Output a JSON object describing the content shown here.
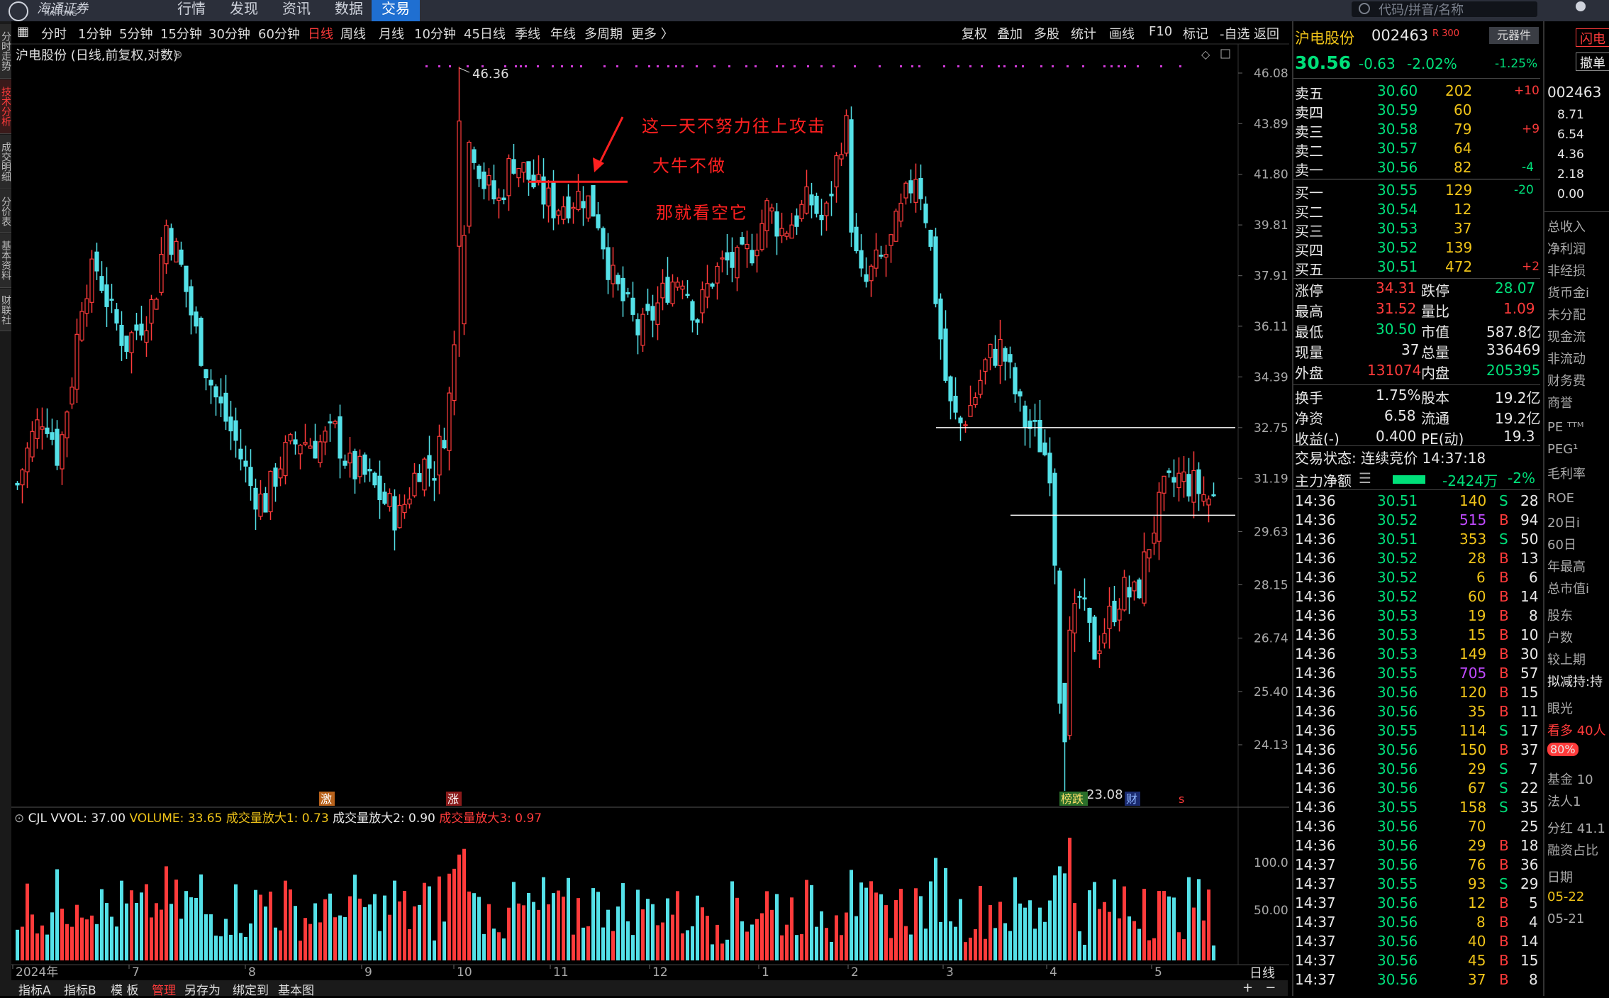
{
  "topbar": {
    "logo_name": "海通证券",
    "logo_sub": "HAITONG",
    "menus": [
      "行情",
      "发现",
      "资讯",
      "数据",
      "交易"
    ],
    "active_menu": "交易",
    "search_placeholder": "代码/拼音/名称"
  },
  "left_tabs": [
    "分时走势",
    "技术分析",
    "成交明细",
    "分价表",
    "基本资料",
    "财联社"
  ],
  "period_bar": {
    "periods": [
      "分时",
      "1分钟",
      "5分钟",
      "15分钟",
      "30分钟",
      "60分钟",
      "日线",
      "周线",
      "月线",
      "10分钟",
      "45日线",
      "季线",
      "年线",
      "多周期",
      "更多 〉"
    ],
    "active": "日线",
    "tools": [
      "复权",
      "叠加",
      "多股",
      "统计",
      "画线",
      "F10",
      "标记",
      "-自选",
      "返回"
    ]
  },
  "chart_title": "沪电股份 (日线,前复权,对数)",
  "annotations": {
    "line1": "这一天不努力往上攻击",
    "line2": "大牛不做",
    "line3": "那就看空它"
  },
  "markers": {
    "high_label": "46.36",
    "low_label": "23.08",
    "tag_ji": "激",
    "tag_zhang": "涨",
    "tag_bang": "榜跌",
    "tag_cai": "财",
    "tag_s": "s"
  },
  "volume_header": {
    "label": "CJL",
    "vvol": "VVOL: 37.00",
    "volume": "VOLUME: 33.65",
    "amp1": "成交量放大1: 0.73",
    "amp2": "成交量放大2: 0.90",
    "amp3": "成交量放大3: 0.97"
  },
  "bottom_tabs": [
    "指标A",
    "指标B",
    "模 板",
    "管理",
    "另存为",
    "绑定到",
    "基本图"
  ],
  "bottom_active": "管理",
  "bottom_right": "日线",
  "chart_data": {
    "type": "candlestick",
    "price_ticks": [
      "46.08",
      "43.89",
      "41.80",
      "39.81",
      "37.91",
      "36.11",
      "34.39",
      "32.75",
      "31.19",
      "29.63",
      "28.15",
      "26.74",
      "25.40",
      "24.13"
    ],
    "volume_ticks": [
      "100.0",
      "50.00"
    ],
    "x_month_labels": [
      "2024年",
      "7",
      "8",
      "9",
      "10",
      "11",
      "12",
      "1",
      "2",
      "3",
      "4",
      "5"
    ],
    "support_lines": [
      32.75,
      30.1
    ],
    "resistance_line": 41.5,
    "high": 46.36,
    "low": 23.08
  },
  "quote": {
    "name": "沪电股份",
    "code": "002463",
    "tag": "R 300",
    "price": "30.56",
    "change": "-0.63",
    "pct": "-2.02%",
    "unit_btn": "元器件",
    "unit_pct": "-1.25%",
    "asks": [
      {
        "label": "卖五",
        "price": "30.60",
        "vol": "202",
        "chg": "+10"
      },
      {
        "label": "卖四",
        "price": "30.59",
        "vol": "60",
        "chg": ""
      },
      {
        "label": "卖三",
        "price": "30.58",
        "vol": "79",
        "chg": "+9"
      },
      {
        "label": "卖二",
        "price": "30.57",
        "vol": "64",
        "chg": ""
      },
      {
        "label": "卖一",
        "price": "30.56",
        "vol": "82",
        "chg": "-4"
      }
    ],
    "bids": [
      {
        "label": "买一",
        "price": "30.55",
        "vol": "129",
        "chg": "-20"
      },
      {
        "label": "买二",
        "price": "30.54",
        "vol": "12",
        "chg": ""
      },
      {
        "label": "买三",
        "price": "30.53",
        "vol": "37",
        "chg": ""
      },
      {
        "label": "买四",
        "price": "30.52",
        "vol": "139",
        "chg": ""
      },
      {
        "label": "买五",
        "price": "30.51",
        "vol": "472",
        "chg": "+2"
      }
    ],
    "stats": [
      {
        "l1": "涨停",
        "v1": "34.31",
        "l2": "跌停",
        "v2": "28.07"
      },
      {
        "l1": "最高",
        "v1": "31.52",
        "l2": "量比",
        "v2": "1.09"
      },
      {
        "l1": "最低",
        "v1": "30.50",
        "l2": "市值",
        "v2": "587.8亿"
      },
      {
        "l1": "现量",
        "v1": "37",
        "l2": "总量",
        "v2": "336469"
      },
      {
        "l1": "外盘",
        "v1": "131074",
        "l2": "内盘",
        "v2": "205395"
      },
      {
        "l1": "换手",
        "v1": "1.75%",
        "l2": "股本",
        "v2": "19.2亿"
      },
      {
        "l1": "净资",
        "v1": "6.58",
        "l2": "流通",
        "v2": "19.2亿"
      },
      {
        "l1": "收益(-)",
        "v1": "0.400",
        "l2": "PE(动)",
        "v2": "19.3"
      }
    ],
    "trade_status": "交易状态: 连续竞价 14:37:18",
    "main_flow_label": "主力净额",
    "main_flow": "-2424万",
    "main_flow_pct": "-2%",
    "ticks": [
      [
        "14:36",
        "30.51",
        "140",
        "S",
        "28"
      ],
      [
        "14:36",
        "30.52",
        "515",
        "B",
        "94"
      ],
      [
        "14:36",
        "30.51",
        "353",
        "S",
        "50"
      ],
      [
        "14:36",
        "30.52",
        "28",
        "B",
        "13"
      ],
      [
        "14:36",
        "30.52",
        "6",
        "B",
        "6"
      ],
      [
        "14:36",
        "30.52",
        "60",
        "B",
        "14"
      ],
      [
        "14:36",
        "30.53",
        "19",
        "B",
        "8"
      ],
      [
        "14:36",
        "30.53",
        "15",
        "B",
        "10"
      ],
      [
        "14:36",
        "30.53",
        "149",
        "B",
        "30"
      ],
      [
        "14:36",
        "30.55",
        "705",
        "B",
        "57"
      ],
      [
        "14:36",
        "30.56",
        "120",
        "B",
        "15"
      ],
      [
        "14:36",
        "30.56",
        "35",
        "B",
        "11"
      ],
      [
        "14:36",
        "30.55",
        "114",
        "S",
        "17"
      ],
      [
        "14:36",
        "30.56",
        "150",
        "B",
        "37"
      ],
      [
        "14:36",
        "30.56",
        "29",
        "S",
        "7"
      ],
      [
        "14:36",
        "30.56",
        "67",
        "S",
        "22"
      ],
      [
        "14:36",
        "30.55",
        "158",
        "S",
        "35"
      ],
      [
        "14:36",
        "30.56",
        "70",
        "",
        "25"
      ],
      [
        "14:36",
        "30.56",
        "29",
        "B",
        "18"
      ],
      [
        "14:37",
        "30.56",
        "76",
        "B",
        "36"
      ],
      [
        "14:37",
        "30.55",
        "93",
        "S",
        "29"
      ],
      [
        "14:37",
        "30.56",
        "12",
        "B",
        "5"
      ],
      [
        "14:37",
        "30.56",
        "8",
        "B",
        "4"
      ],
      [
        "14:37",
        "30.56",
        "40",
        "B",
        "14"
      ],
      [
        "14:37",
        "30.56",
        "45",
        "B",
        "15"
      ],
      [
        "14:37",
        "30.56",
        "37",
        "B",
        "8"
      ]
    ]
  },
  "side": {
    "buttons": [
      "闪电",
      "撤单"
    ],
    "code": "002463",
    "levels": [
      "8.71",
      "6.54",
      "4.36",
      "2.18",
      "0.00"
    ],
    "items": [
      "总收入",
      "净利润",
      "非经损",
      "货币金i",
      "未分配",
      "现金流",
      "非流动",
      "财务费",
      "商誉",
      "PE ᵀᵀᴹ",
      "PEG¹",
      "毛利率",
      "ROE",
      "20日i",
      "60日",
      "年最高",
      "总市值i",
      "股东",
      "户数",
      "较上期",
      "拟减持:持",
      "眼光",
      "看多 40人",
      "80%",
      "基金 10",
      "法人1",
      "分红 41.1",
      "融资占比",
      "日期",
      "05-22",
      "05-21"
    ]
  }
}
